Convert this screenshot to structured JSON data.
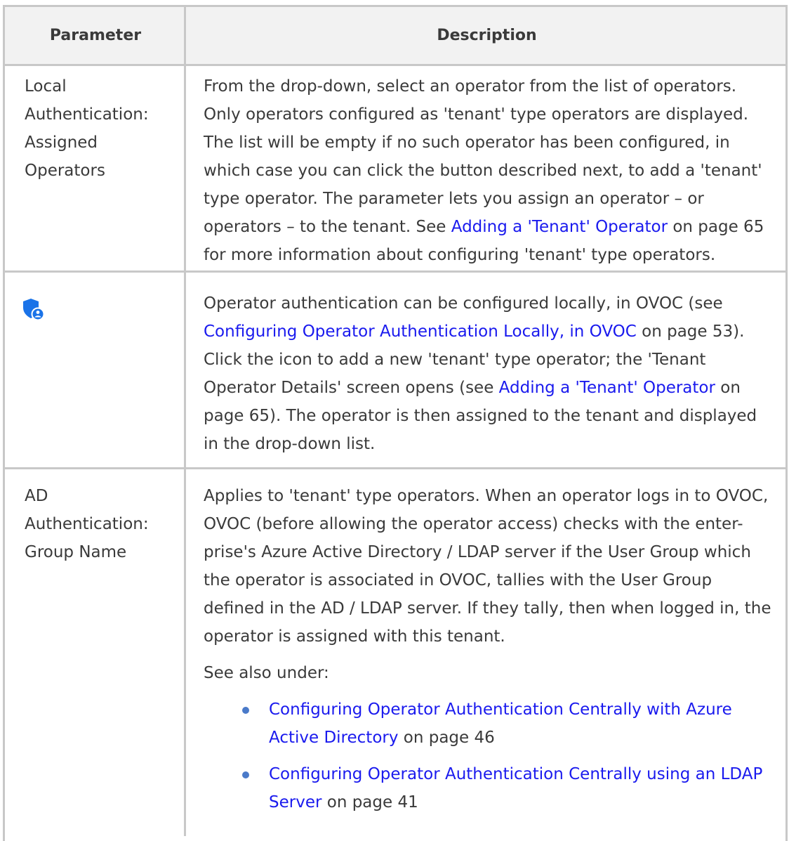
{
  "header": {
    "parameter": "Parameter",
    "description": "Description"
  },
  "rows": [
    {
      "param": [
        "Local",
        "Authentication:",
        "Assigned",
        "Operators"
      ],
      "desc": {
        "text1": "From the drop-down, select an operator from the list of operators. Only operators configured as 'tenant' type operators are displayed. The list will be empty if no such operator has been configured, in which case you can click the button described next, to add a 'tenant' type operator. The parameter lets you assign an operator – or operators – to the tenant. See ",
        "link1": "Adding a 'Tenant' Operator",
        "text2": "  on page 65 for more information about configuring 'tenant' type operators."
      }
    },
    {
      "icon": "shield-user-icon",
      "desc": {
        "text1": "Operator authentication can be configured locally, in OVOC (see ",
        "link1": "Configuring Operator Authentication Locally, in OVOC",
        "text2": " on page 53). Click the icon to add a new 'tenant' type operator; the 'Tenant Operator Details' screen opens (see ",
        "link2": "Adding a 'Tenant' Operator",
        "text3": "  on page 65). The operator is then assigned to the tenant and displayed in the drop-down list."
      }
    },
    {
      "param": [
        "AD",
        "Authentication:",
        "Group Name"
      ],
      "desc": {
        "text1": "Applies to 'tenant' type operators. When an operator logs in to OVOC, OVOC (before allowing the operator access) checks with the enter-prise's Azure Active Directory / LDAP server if the User Group which the operator is associated in OVOC, tallies with the User Group defined in the AD / LDAP server. If they tally, then when logged in, the operator is assigned with this tenant.",
        "see_also": "See also under:",
        "bullets": [
          {
            "link": "Configuring Operator Authentication Centrally with Azure Active Directory",
            "suffix": " on page 46"
          },
          {
            "link": "Configuring Operator Authentication Centrally using an LDAP Server",
            "suffix": " on page 41"
          }
        ]
      }
    }
  ],
  "colors": {
    "link": "#1a1aee",
    "icon": "#1a73e8",
    "border": "#c8c8c8",
    "header_bg": "#f2f2f2"
  }
}
